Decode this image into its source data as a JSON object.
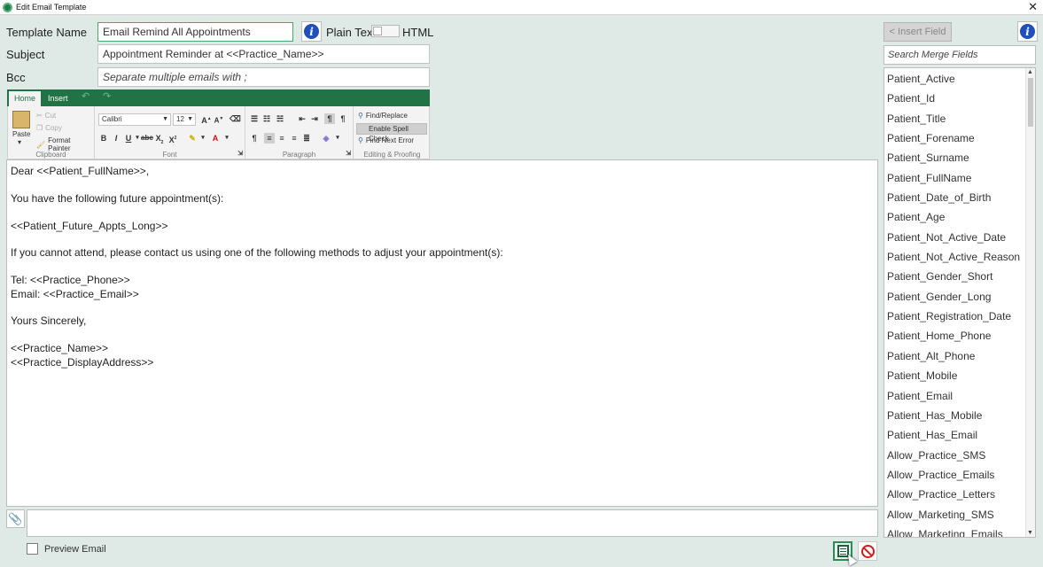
{
  "window": {
    "title": "Edit Email Template"
  },
  "form": {
    "template_name_label": "Template Name",
    "template_name_value": "Email Remind All Appointments",
    "subject_label": "Subject",
    "subject_value": "Appointment Reminder at <<Practice_Name>>",
    "bcc_label": "Bcc",
    "bcc_placeholder": "Separate multiple emails with ;",
    "plain_text_label": "Plain Text",
    "html_label": "HTML",
    "format_toggle": "plain"
  },
  "ribbon": {
    "tabs": [
      "Home",
      "Insert"
    ],
    "clipboard": {
      "paste": "Paste",
      "cut": "Cut",
      "copy": "Copy",
      "format_painter": "Format Painter",
      "group": "Clipboard"
    },
    "font": {
      "family": "Calibri",
      "size": "12",
      "group": "Font"
    },
    "paragraph": {
      "group": "Paragraph"
    },
    "editing": {
      "find_replace": "Find/Replace",
      "spell_check": "Enable Spell Check",
      "find_next_error": "Find Next Error",
      "group": "Editing & Proofing"
    }
  },
  "body_lines": [
    "Dear <<Patient_FullName>>,",
    "",
    "You have the following future appointment(s):",
    "",
    "<<Patient_Future_Appts_Long>>",
    "",
    "If you cannot attend, please contact us using one of the following methods to adjust your appointment(s):",
    "",
    "Tel: <<Practice_Phone>>",
    "Email: <<Practice_Email>>",
    "",
    "Yours Sincerely,",
    "",
    "<<Practice_Name>>",
    "<<Practice_DisplayAddress>>"
  ],
  "footer": {
    "preview_label": "Preview Email"
  },
  "merge": {
    "insert_label": "< Insert Field",
    "search_placeholder": "Search Merge Fields",
    "fields": [
      "Patient_Active",
      "Patient_Id",
      "Patient_Title",
      "Patient_Forename",
      "Patient_Surname",
      "Patient_FullName",
      "Patient_Date_of_Birth",
      "Patient_Age",
      "Patient_Not_Active_Date",
      "Patient_Not_Active_Reason",
      "Patient_Gender_Short",
      "Patient_Gender_Long",
      "Patient_Registration_Date",
      "Patient_Home_Phone",
      "Patient_Alt_Phone",
      "Patient_Mobile",
      "Patient_Email",
      "Patient_Has_Mobile",
      "Patient_Has_Email",
      "Allow_Practice_SMS",
      "Allow_Practice_Emails",
      "Allow_Practice_Letters",
      "Allow_Marketing_SMS",
      "Allow_Marketing_Emails"
    ]
  },
  "colors": {
    "ribbon_green": "#217346",
    "info_blue": "#1f4fb8",
    "cancel_red": "#d41b1b",
    "background": "#dfe9e6"
  }
}
